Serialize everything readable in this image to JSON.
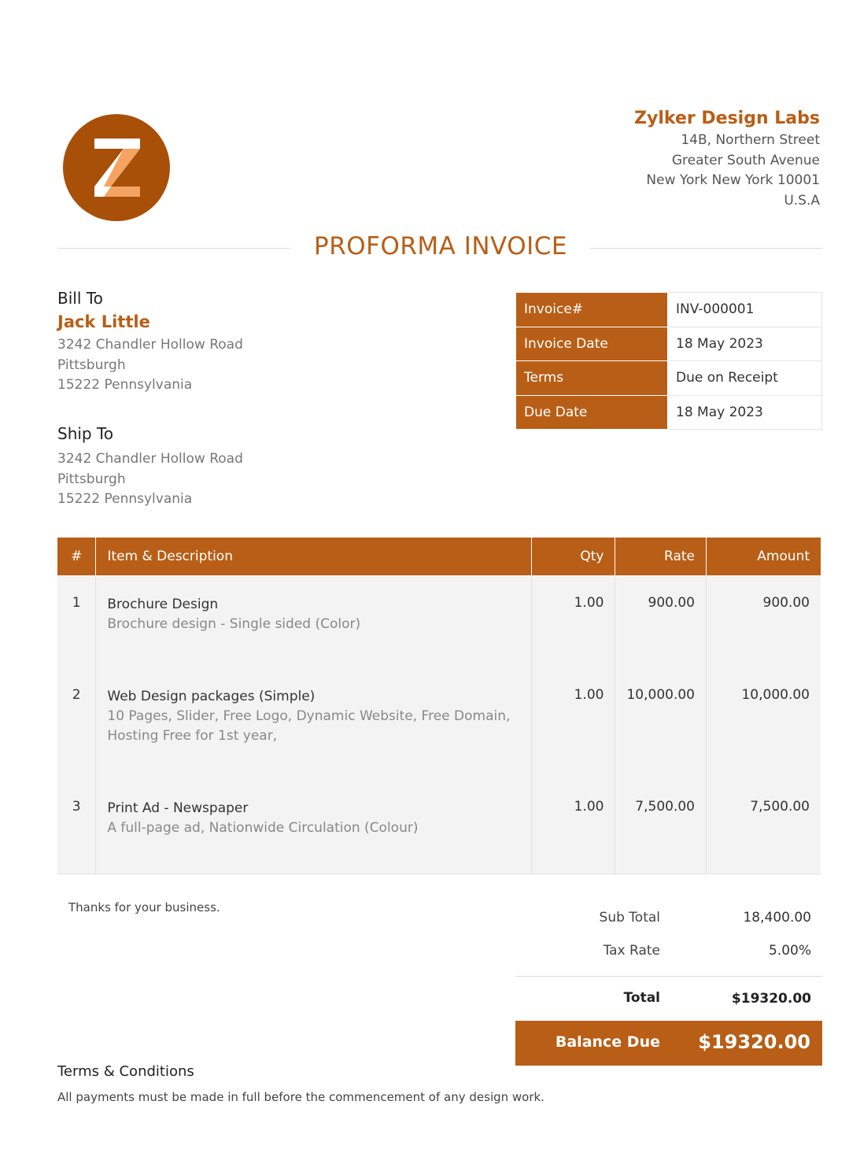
{
  "company": {
    "logo_letter": "Z",
    "name": "Zylker Design Labs",
    "address": [
      "14B, Northern Street",
      "Greater South Avenue",
      "New York New York 10001",
      "U.S.A"
    ]
  },
  "document_title": "PROFORMA INVOICE",
  "bill_to": {
    "heading": "Bill To",
    "name": "Jack Little",
    "address": [
      "3242 Chandler Hollow Road",
      "Pittsburgh",
      "15222 Pennsylvania"
    ]
  },
  "ship_to": {
    "heading": "Ship To",
    "address": [
      "3242 Chandler Hollow Road",
      "Pittsburgh",
      "15222 Pennsylvania"
    ]
  },
  "invoice_meta": [
    {
      "label": "Invoice#",
      "value": "INV-000001"
    },
    {
      "label": "Invoice Date",
      "value": "18 May 2023"
    },
    {
      "label": "Terms",
      "value": "Due on Receipt"
    },
    {
      "label": "Due Date",
      "value": "18 May 2023"
    }
  ],
  "items_table": {
    "headers": {
      "num": "#",
      "item": "Item & Description",
      "qty": "Qty",
      "rate": "Rate",
      "amount": "Amount"
    },
    "rows": [
      {
        "num": "1",
        "name": "Brochure Design",
        "description": [
          "Brochure design - Single sided (Color)"
        ],
        "qty": "1.00",
        "rate": "900.00",
        "amount": "900.00"
      },
      {
        "num": "2",
        "name": "Web Design packages (Simple)",
        "description": [
          "10 Pages, Slider, Free Logo, Dynamic Website, Free Domain,",
          "Hosting Free for 1st year,"
        ],
        "qty": "1.00",
        "rate": "10,000.00",
        "amount": "10,000.00"
      },
      {
        "num": "3",
        "name": "Print Ad - Newspaper",
        "description": [
          "A full-page ad, Nationwide Circulation (Colour)"
        ],
        "qty": "1.00",
        "rate": "7,500.00",
        "amount": "7,500.00"
      }
    ]
  },
  "notes": "Thanks for your business.",
  "totals": {
    "sub_total_label": "Sub Total",
    "sub_total": "18,400.00",
    "tax_rate_label": "Tax Rate",
    "tax_rate": "5.00%",
    "total_label": "Total",
    "total": "$19320.00",
    "balance_due_label": "Balance Due",
    "balance_due": "$19320.00"
  },
  "terms": {
    "title": "Terms & Conditions",
    "text": "All payments must be made in full before the commencement of any design work."
  },
  "colors": {
    "accent": "#b85e16",
    "logo_bg": "#a84f08",
    "row_bg": "#f3f3f3"
  }
}
